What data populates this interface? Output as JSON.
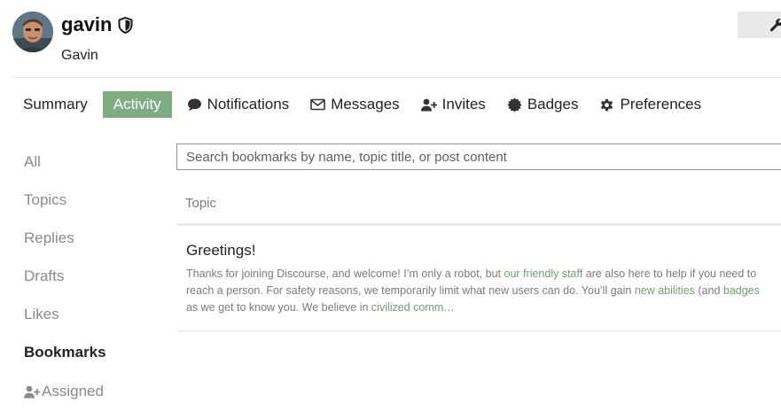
{
  "user": {
    "username": "gavin",
    "full_name": "Gavin"
  },
  "nav": {
    "tabs": [
      {
        "label": "Summary",
        "icon": null
      },
      {
        "label": "Activity",
        "icon": null,
        "active": true
      },
      {
        "label": "Notifications",
        "icon": "comment-icon"
      },
      {
        "label": "Messages",
        "icon": "envelope-icon"
      },
      {
        "label": "Invites",
        "icon": "user-plus-icon"
      },
      {
        "label": "Badges",
        "icon": "certificate-icon"
      },
      {
        "label": "Preferences",
        "icon": "gear-icon"
      }
    ]
  },
  "sidebar": {
    "items": [
      {
        "label": "All"
      },
      {
        "label": "Topics"
      },
      {
        "label": "Replies"
      },
      {
        "label": "Drafts"
      },
      {
        "label": "Likes"
      },
      {
        "label": "Bookmarks",
        "active": true
      },
      {
        "label": "Assigned",
        "icon": "user-plus-icon"
      }
    ]
  },
  "search": {
    "placeholder": "Search bookmarks by name, topic title, or post content",
    "value": ""
  },
  "table": {
    "column_header": "Topic"
  },
  "bookmarks": [
    {
      "title": "Greetings!",
      "excerpt": {
        "l1a": "Thanks for joining Discourse, and welcome! I’m only a robot, but ",
        "l1_link": "our friendly staff",
        "l1b": " are also here to help if you need to",
        "l2a": "reach a person. For safety reasons, we temporarily limit what new users can do. You’ll gain ",
        "l2_link1": "new abilities",
        "l2b": " (and ",
        "l2_link2": "badges",
        "l3a": "as we get to know you. We believe in ",
        "l3_link": "civilized comm…"
      }
    }
  ],
  "colors": {
    "accent": "#7fad83",
    "link": "#6e9e74",
    "muted_text": "#8a8a8a"
  }
}
